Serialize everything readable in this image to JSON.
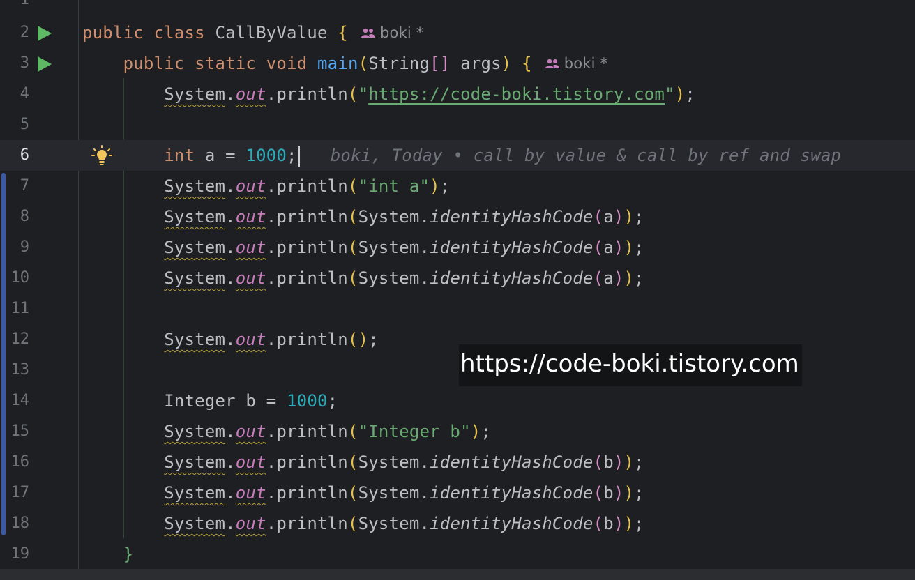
{
  "editor": {
    "current_line": "6",
    "author": {
      "name": "boki",
      "modified_marker": "*"
    },
    "inlay_hint": "boki, Today • call by value & call by ref and swap",
    "line_numbers": [
      "1",
      "2",
      "3",
      "4",
      "5",
      "6",
      "7",
      "8",
      "9",
      "10",
      "11",
      "12",
      "13",
      "14",
      "15",
      "16",
      "17",
      "18",
      "19"
    ],
    "tokens": {
      "public": "public",
      "class": "class",
      "static": "static",
      "void": "void",
      "int": "int",
      "class_name": "CallByValue",
      "main": "main",
      "string_array": "String",
      "args": "args",
      "system": "System",
      "out": "out",
      "println": "println",
      "identity": "identityHashCode",
      "integer": "Integer",
      "var_a": "a",
      "var_b": "b",
      "num_1000": "1000",
      "str_url": "https://code-boki.tistory.com",
      "str_int_a": "int a",
      "str_integer_b": "Integer b"
    },
    "colors": {
      "background": "#1e1f22",
      "keyword": "#cf8e6d",
      "string": "#6aab73",
      "number": "#2aacb8",
      "field": "#c77dbb",
      "method": "#56a8f5",
      "run_icon": "#5fb865",
      "vcs_bar": "#3b5aa3"
    }
  },
  "watermark": {
    "text": "https://code-boki.tistory.com"
  }
}
